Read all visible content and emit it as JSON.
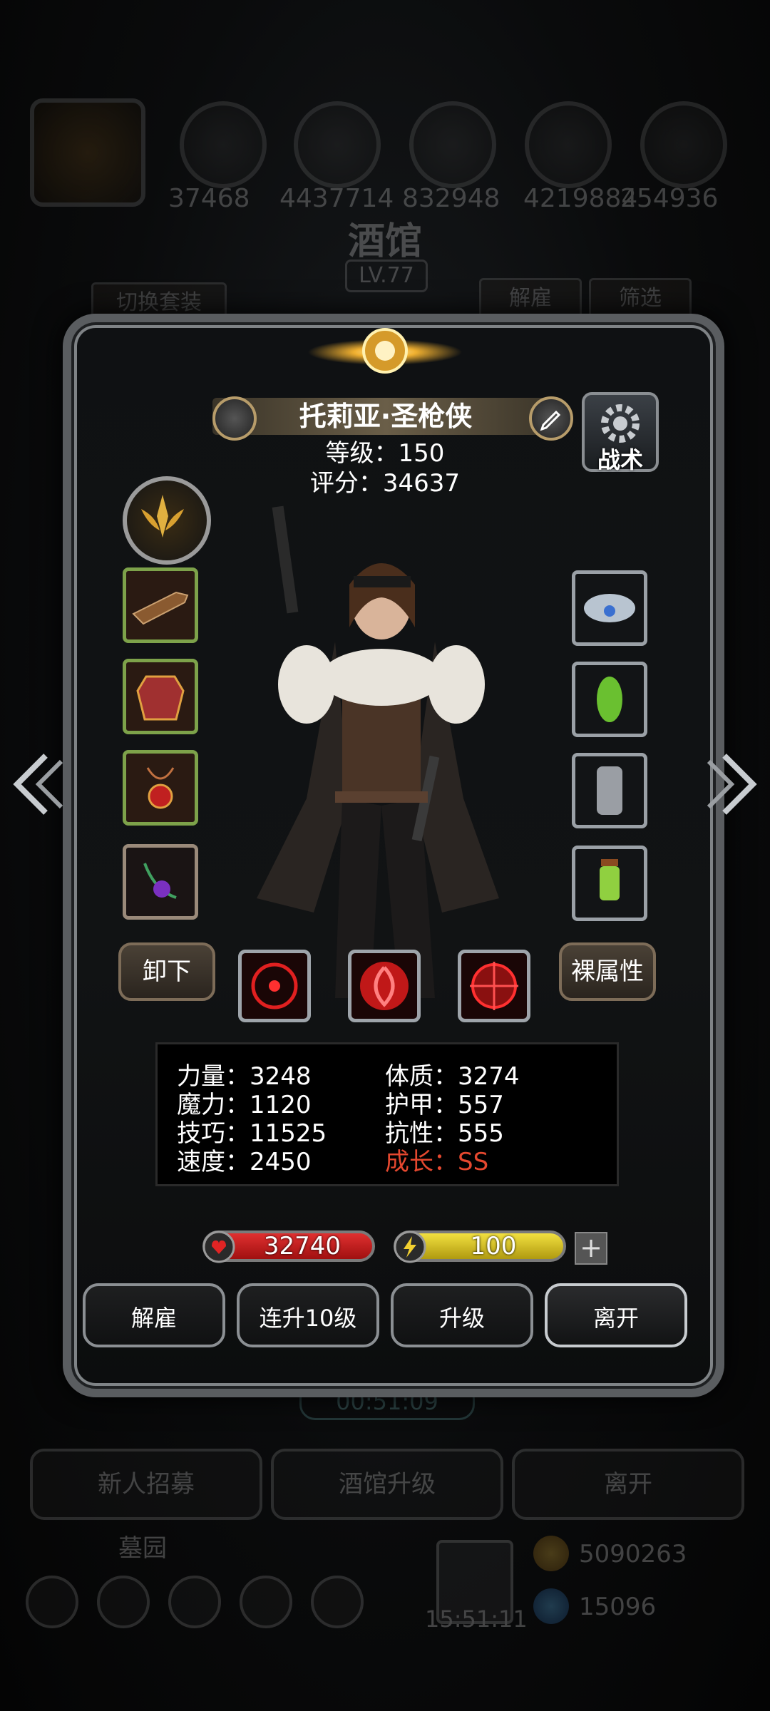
{
  "background": {
    "resource_numbers": [
      "37468",
      "4437714",
      "832948",
      "4219884",
      "254936"
    ],
    "title": "酒馆",
    "level": "LV.77",
    "tabs": {
      "switch_outfit": "切换套装",
      "dismiss": "解雇",
      "filter": "筛选"
    },
    "timer": "00:51:09",
    "buttons": [
      "新人招募",
      "酒馆升级",
      "离开"
    ],
    "section_label": "墓园",
    "clock": "15:51:11",
    "currency_gold": "5090263",
    "currency_gem": "15096"
  },
  "hero": {
    "name": "托莉亚·圣枪侠",
    "level_text": "等级：150",
    "score_text": "评分：34637"
  },
  "tactics_label": "战术",
  "unequip_label": "卸下",
  "naked_attr_label": "裸属性",
  "stats": {
    "strength": "力量：3248",
    "constitution": "体质：3274",
    "magic": "魔力：1120",
    "armor": "护甲：557",
    "skill": "技巧：11525",
    "resistance": "抗性：555",
    "speed": "速度：2450",
    "growth": "成长：SS"
  },
  "hp_value": "32740",
  "energy_value": "100",
  "plus_label": "+",
  "actions": {
    "dismiss": "解雇",
    "level10": "连升10级",
    "upgrade": "升级",
    "leave": "离开"
  },
  "colors": {
    "hp_bar": "#c8201e",
    "energy_bar": "#d8c41a",
    "growth_text": "#e5482f",
    "equip_green_frame": "#7da24a"
  },
  "icons": {
    "equip_left": [
      "musket-icon",
      "armor-icon",
      "amulet-icon",
      "necklace-icon"
    ],
    "equip_right": [
      "cloud-ring-icon",
      "green-gem-icon",
      "chainmail-icon",
      "lantern-icon"
    ],
    "skills": [
      "crosshair-skill-icon",
      "swirl-skill-icon",
      "target-skill-icon"
    ]
  }
}
